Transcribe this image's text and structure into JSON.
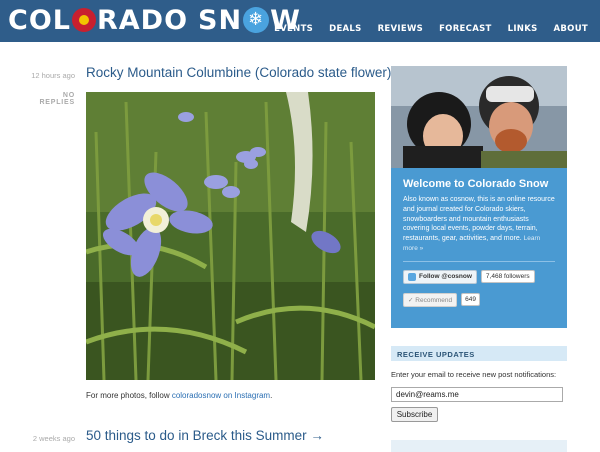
{
  "brand": {
    "part1": "COL",
    "part2": "RADO",
    "part3": "SN",
    "part4": "W"
  },
  "nav": {
    "items": [
      "EVENTS",
      "DEALS",
      "REVIEWS",
      "FORECAST",
      "LINKS",
      "ABOUT"
    ]
  },
  "posts": [
    {
      "time": "12 hours ago",
      "replies": "NO REPLIES",
      "title": "Rocky Mountain Columbine (Colorado state flower)",
      "caption_prefix": "For more photos, follow ",
      "caption_link": "coloradosnow on Instagram",
      "caption_suffix": "."
    },
    {
      "time": "2 weeks ago",
      "title": "50 things to do in Breck this Summer →"
    }
  ],
  "sidebar": {
    "welcome_title": "Welcome to Colorado Snow",
    "welcome_text": "Also known as cosnow, this is an online resource and journal created for Colorado skiers, snowboarders and mountain enthusiasts covering local events, powder days, terrain, restaurants, gear, activities, and more.",
    "learn_more": "Learn more »",
    "follow_label": "Follow @cosnow",
    "followers": "7,468 followers",
    "recommend_label": "Recommend",
    "recommend_count": "649",
    "receive_heading": "RECEIVE UPDATES",
    "receive_desc": "Enter your email to receive new post notifications:",
    "email_value": "devin@reams.me",
    "subscribe_label": "Subscribe"
  },
  "colors": {
    "header": "#2f5d8a",
    "title_link": "#2b5b8a",
    "welcome_bg": "#4a9ad2"
  }
}
